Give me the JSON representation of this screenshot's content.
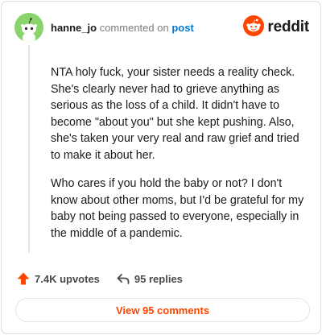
{
  "comment": {
    "username": "hanne_jo",
    "action_text": "commented on",
    "post_link": "post",
    "avatar_icon": "snoo-avatar-icon",
    "paragraphs": [
      "NTA holy fuck, your sister needs a reality check. She's clearly never had to grieve anything as serious as the loss of a child. It didn't have to become \"about you\" but she kept pushing. Also, she's taken your very real and raw grief and tried to make it about her.",
      "Who cares if you hold the baby or not? I don't know about other moms, but I'd be grateful for my baby not being passed to everyone, especially in the middle of a pandemic."
    ]
  },
  "brand": {
    "wordmark": "reddit",
    "icon": "reddit-alien-icon",
    "accent_color": "#ff4500"
  },
  "actions": {
    "upvotes": "7.4K upvotes",
    "replies": "95 replies",
    "upvote_icon": "upvote-arrow-icon",
    "reply_icon": "reply-arrow-icon"
  },
  "view_comments_label": "View 95 comments"
}
